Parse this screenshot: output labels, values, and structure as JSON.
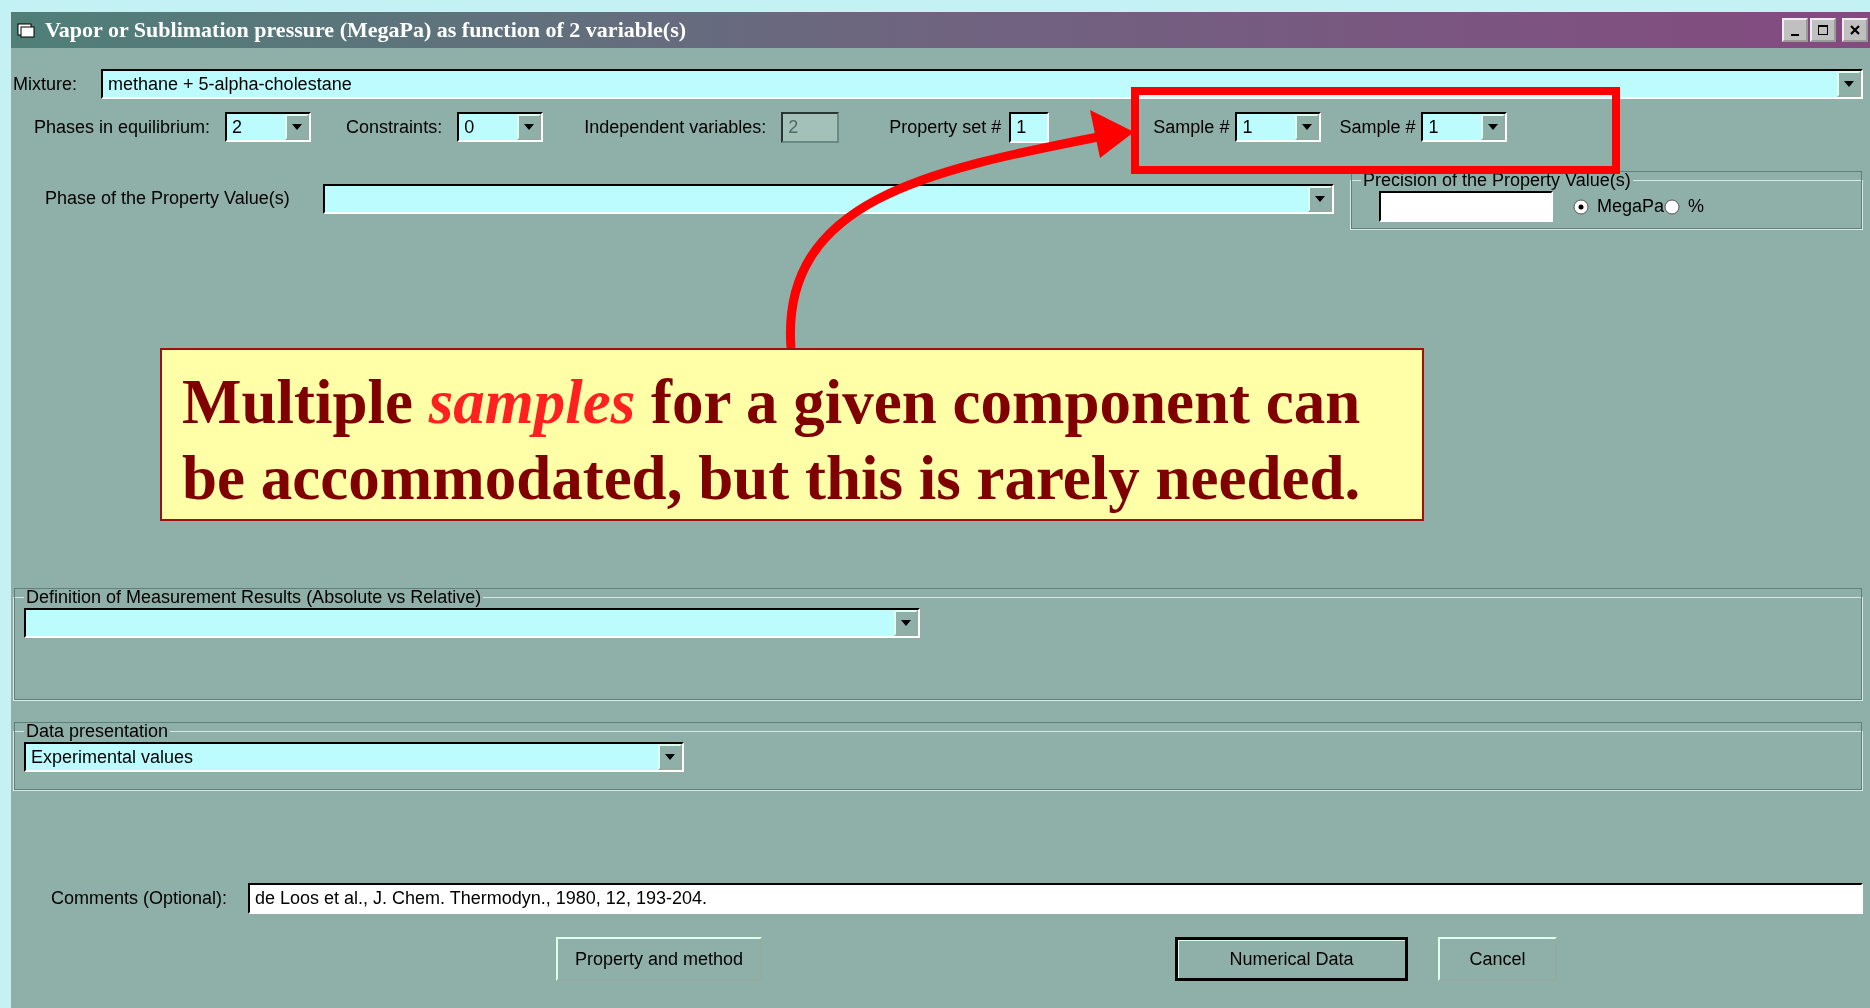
{
  "window": {
    "title": "Vapor or Sublimation pressure (MegaPa) as function of 2 variable(s)"
  },
  "mixture": {
    "label": "Mixture:",
    "value": "methane + 5-alpha-cholestane"
  },
  "phases": {
    "label": "Phases in equilibrium:",
    "value": "2"
  },
  "constraints": {
    "label": "Constraints:",
    "value": "0"
  },
  "independent_variables": {
    "label": "Independent variables:",
    "value": "2",
    "disabled": true
  },
  "property_set": {
    "label": "Property set #",
    "value": "1"
  },
  "samples": [
    {
      "label": "Sample #",
      "value": "1"
    },
    {
      "label": "Sample #",
      "value": "1"
    }
  ],
  "precision": {
    "title": "Precision of the Property Value(s)",
    "units": [
      {
        "label": "MegaPa",
        "selected": true
      },
      {
        "label": "%",
        "selected": false
      }
    ]
  },
  "phase_of_property": {
    "label": "Phase of the Property Value(s)"
  },
  "definition": {
    "title": "Definition of Measurement Results (Absolute vs Relative)"
  },
  "data_presentation": {
    "title": "Data presentation",
    "value": "Experimental values"
  },
  "comments": {
    "label": "Comments (Optional):",
    "value": "de Loos et al., J. Chem. Thermodyn., 1980, 12, 193-204."
  },
  "buttons": [
    {
      "label": "Property and method",
      "default": false
    },
    {
      "label": "Numerical Data",
      "default": true
    },
    {
      "label": "Cancel",
      "default": false
    }
  ],
  "callout": {
    "text": "Multiple *samples* for a given component can be accommodated, but this is rarely needed."
  }
}
